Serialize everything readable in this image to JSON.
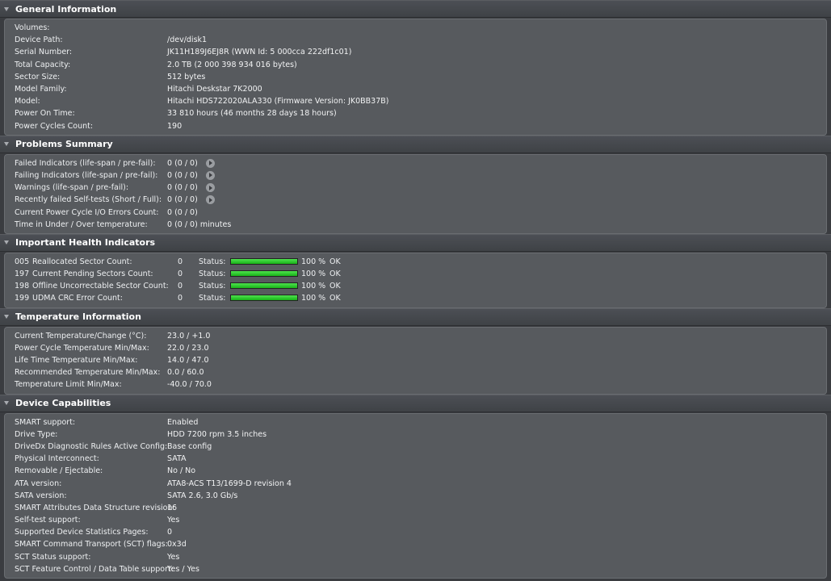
{
  "general": {
    "title": "General Information",
    "rows": [
      {
        "label": "Volumes:",
        "value": ""
      },
      {
        "label": "Device Path:",
        "value": "/dev/disk1"
      },
      {
        "label": "Serial Number:",
        "value": "JK11H189J6EJ8R (WWN Id: 5 000cca 222df1c01)"
      },
      {
        "label": "Total Capacity:",
        "value": "2.0 TB (2 000 398 934 016 bytes)"
      },
      {
        "label": "Sector Size:",
        "value": "512 bytes"
      },
      {
        "label": "Model Family:",
        "value": "Hitachi Deskstar 7K2000"
      },
      {
        "label": "Model:",
        "value": "Hitachi HDS722020ALA330  (Firmware Version: JK0BB37B)"
      },
      {
        "label": "Power On Time:",
        "value": "33 810 hours (46 months 28 days 18 hours)"
      },
      {
        "label": "Power Cycles Count:",
        "value": "190"
      }
    ]
  },
  "problems": {
    "title": "Problems Summary",
    "rows": [
      {
        "label": "Failed Indicators (life-span / pre-fail):",
        "value": "0 (0 / 0)",
        "has_button": true
      },
      {
        "label": "Failing Indicators (life-span / pre-fail):",
        "value": "0 (0 / 0)",
        "has_button": true
      },
      {
        "label": "Warnings (life-span / pre-fail):",
        "value": "0 (0 / 0)",
        "has_button": true
      },
      {
        "label": "Recently failed Self-tests (Short / Full):",
        "value": "0 (0 / 0)",
        "has_button": true
      },
      {
        "label": "Current Power Cycle I/O Errors Count:",
        "value": "0 (0 / 0)",
        "has_button": false
      },
      {
        "label": "Time in Under / Over temperature:",
        "value": "0 (0 / 0)   minutes",
        "has_button": false
      }
    ]
  },
  "health": {
    "title": "Important Health Indicators",
    "status_label": "Status:",
    "bar_color": "#2ecc2e",
    "rows": [
      {
        "code": "005",
        "label": "Reallocated Sector Count:",
        "value": "0",
        "percent": 100,
        "percent_text": "100 %",
        "status": "OK"
      },
      {
        "code": "197",
        "label": "Current Pending Sectors Count:",
        "value": "0",
        "percent": 100,
        "percent_text": "100 %",
        "status": "OK"
      },
      {
        "code": "198",
        "label": "Offline Uncorrectable Sector Count:",
        "value": "0",
        "percent": 100,
        "percent_text": "100 %",
        "status": "OK"
      },
      {
        "code": "199",
        "label": "UDMA CRC Error Count:",
        "value": "0",
        "percent": 100,
        "percent_text": "100 %",
        "status": "OK"
      }
    ]
  },
  "temperature": {
    "title": "Temperature Information",
    "rows": [
      {
        "label": "Current Temperature/Change (°C):",
        "value": "23.0   / +1.0"
      },
      {
        "label": "Power Cycle Temperature Min/Max:",
        "value": "22.0   / 23.0"
      },
      {
        "label": "Life Time Temperature Min/Max:",
        "value": "14.0   / 47.0"
      },
      {
        "label": "Recommended Temperature Min/Max:",
        "value": "0.0     / 60.0"
      },
      {
        "label": "Temperature Limit Min/Max:",
        "value": "-40.0  / 70.0"
      }
    ]
  },
  "capabilities": {
    "title": "Device Capabilities",
    "rows": [
      {
        "label": "SMART support:",
        "value": "Enabled"
      },
      {
        "label": "Drive Type:",
        "value": "HDD 7200 rpm 3.5 inches"
      },
      {
        "label": "DriveDx Diagnostic Rules Active Config:",
        "value": "Base config"
      },
      {
        "label": "Physical Interconnect:",
        "value": "SATA"
      },
      {
        "label": "Removable / Ejectable:",
        "value": "No / No"
      },
      {
        "label": "ATA version:",
        "value": "ATA8-ACS T13/1699-D revision 4"
      },
      {
        "label": "SATA version:",
        "value": "SATA 2.6, 3.0 Gb/s"
      },
      {
        "label": "SMART Attributes Data Structure revision:",
        "value": "16"
      },
      {
        "label": "Self-test support:",
        "value": "Yes"
      },
      {
        "label": "Supported Device Statistics Pages:",
        "value": "0"
      },
      {
        "label": "SMART Command Transport (SCT) flags:",
        "value": "0x3d"
      },
      {
        "label": "SCT Status support:",
        "value": "Yes"
      },
      {
        "label": "SCT Feature Control / Data Table support:",
        "value": "Yes / Yes"
      }
    ]
  }
}
